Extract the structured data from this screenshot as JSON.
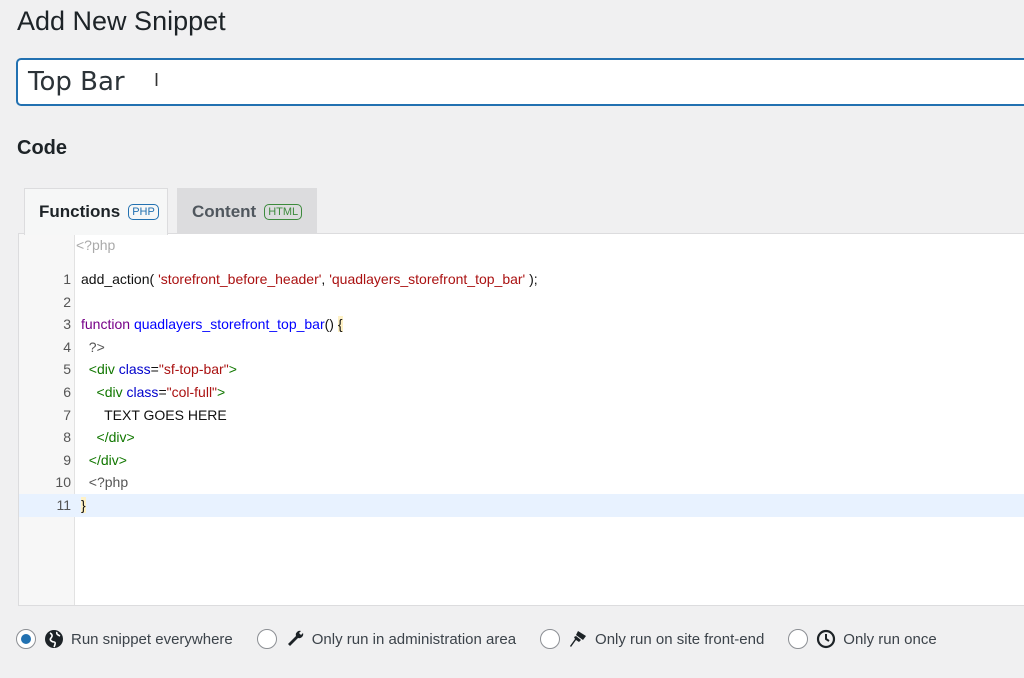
{
  "page_title": "Add New Snippet",
  "snippet_name": {
    "value": "Top Bar"
  },
  "code_label": "Code",
  "tabs": [
    {
      "label": "Functions",
      "badge": "PHP",
      "active": true
    },
    {
      "label": "Content",
      "badge": "HTML",
      "active": false
    }
  ],
  "editor": {
    "header": "<?php",
    "lines": [
      {
        "n": "1",
        "tokens": [
          [
            "plain",
            "add_action( "
          ],
          [
            "str",
            "'storefront_before_header'"
          ],
          [
            "plain",
            ", "
          ],
          [
            "str",
            "'quadlayers_storefront_top_bar'"
          ],
          [
            "plain",
            " );"
          ]
        ]
      },
      {
        "n": "2",
        "tokens": []
      },
      {
        "n": "3",
        "tokens": [
          [
            "kw",
            "function "
          ],
          [
            "def",
            "quadlayers_storefront_top_bar"
          ],
          [
            "plain",
            "() "
          ],
          [
            "bracket",
            "{"
          ]
        ]
      },
      {
        "n": "4",
        "tokens": [
          [
            "meta",
            "  ?>"
          ]
        ]
      },
      {
        "n": "5",
        "tokens": [
          [
            "tag",
            "  <div "
          ],
          [
            "attr",
            "class"
          ],
          [
            "plain",
            "="
          ],
          [
            "str",
            "\"sf-top-bar\""
          ],
          [
            "tag",
            ">"
          ]
        ]
      },
      {
        "n": "6",
        "tokens": [
          [
            "tag",
            "    <div "
          ],
          [
            "attr",
            "class"
          ],
          [
            "plain",
            "="
          ],
          [
            "str",
            "\"col-full\""
          ],
          [
            "tag",
            ">"
          ]
        ]
      },
      {
        "n": "7",
        "tokens": [
          [
            "plain",
            "      TEXT GOES HERE"
          ]
        ]
      },
      {
        "n": "8",
        "tokens": [
          [
            "tag",
            "    </div>"
          ]
        ]
      },
      {
        "n": "9",
        "tokens": [
          [
            "tag",
            "  </div>"
          ]
        ]
      },
      {
        "n": "10",
        "tokens": [
          [
            "meta",
            "  <?php"
          ]
        ]
      },
      {
        "n": "11",
        "tokens": [
          [
            "bracket",
            "}"
          ]
        ],
        "active": true
      }
    ]
  },
  "scope_options": [
    {
      "label": "Run snippet everywhere",
      "icon": "globe-icon",
      "checked": true
    },
    {
      "label": "Only run in administration area",
      "icon": "wrench-icon",
      "checked": false
    },
    {
      "label": "Only run on site front-end",
      "icon": "paintbrush-icon",
      "checked": false
    },
    {
      "label": "Only run once",
      "icon": "clock-icon",
      "checked": false
    }
  ],
  "colors": {
    "accent": "#2271b1"
  }
}
